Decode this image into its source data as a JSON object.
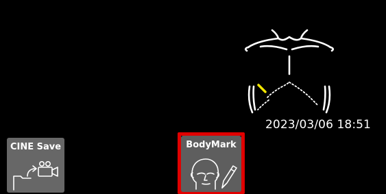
{
  "timestamp": "2023/03/06 18:51",
  "buttons": {
    "cine_save": {
      "label": "CINE Save",
      "icon": "folder-camera-icon"
    },
    "bodymark": {
      "label": "BodyMark",
      "icon": "head-pencil-icon",
      "highlighted": true
    }
  },
  "colors": {
    "background": "#000000",
    "tile": "#676767",
    "highlight": "#e00000",
    "probe_marker": "#f2e600"
  },
  "bodymark_diagram": {
    "icon": "chest-torso-icon",
    "probe_marker": "probe-marker-icon"
  }
}
